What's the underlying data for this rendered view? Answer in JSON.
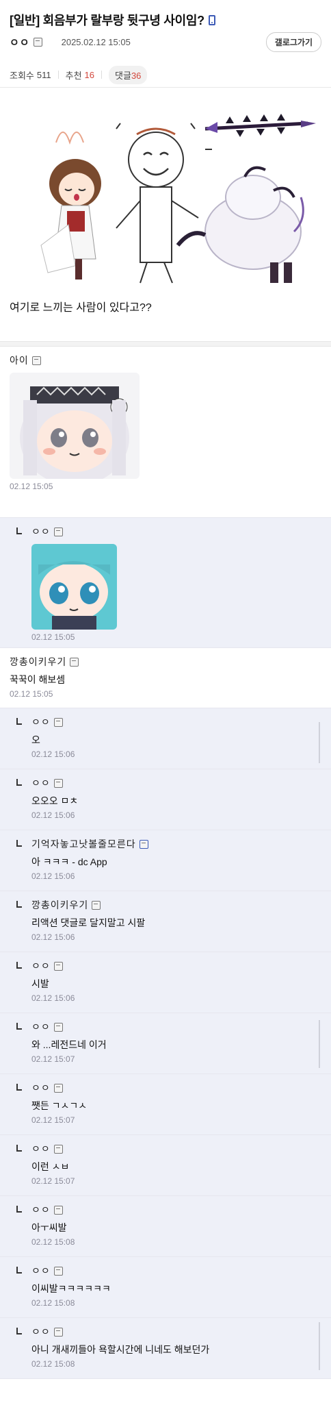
{
  "post": {
    "title": "[일반] 회음부가 랄부랑 뒷구녕 사이임?",
    "author": "ㅇㅇ",
    "date": "2025.02.12 15:05",
    "gallery_button": "갤로그가기",
    "views_label": "조회수",
    "views": "511",
    "recommend_label": "추천",
    "recommend": "16",
    "comments_label": "댓글",
    "comments": "36",
    "body": "여기로 느끼는 사람이 있다고??"
  },
  "comments": [
    {
      "name": "아이",
      "text": "",
      "date": "02.12 15:05",
      "reply": false,
      "sticker": "large"
    },
    {
      "name": "ㅇㅇ",
      "text": "",
      "date": "02.12 15:05",
      "reply": true,
      "sticker": "small"
    },
    {
      "name": "깡총이키우기",
      "text": "꾹꾹이 해보셈",
      "date": "02.12 15:05",
      "reply": false
    },
    {
      "name": "ㅇㅇ",
      "text": "오",
      "date": "02.12 15:06",
      "reply": true
    },
    {
      "name": "ㅇㅇ",
      "text": "오오오 ㅁㅊ",
      "date": "02.12 15:06",
      "reply": true
    },
    {
      "name": "기억자놓고낫볼줄모른다",
      "text": "아 ㅋㅋㅋ - dc App",
      "date": "02.12 15:06",
      "reply": true
    },
    {
      "name": "깡총이키우기",
      "text": "리액션 댓글로 달지말고 시팔",
      "date": "02.12 15:06",
      "reply": true
    },
    {
      "name": "ㅇㅇ",
      "text": "시발",
      "date": "02.12 15:06",
      "reply": true
    },
    {
      "name": "ㅇㅇ",
      "text": "와 ...레전드네 이거",
      "date": "02.12 15:07",
      "reply": true
    },
    {
      "name": "ㅇㅇ",
      "text": "쨋든 ㄱㅅㄱㅅ",
      "date": "02.12 15:07",
      "reply": true
    },
    {
      "name": "ㅇㅇ",
      "text": "이런 ㅅㅂ",
      "date": "02.12 15:07",
      "reply": true
    },
    {
      "name": "ㅇㅇ",
      "text": "아ㅜ씨발",
      "date": "02.12 15:08",
      "reply": true
    },
    {
      "name": "ㅇㅇ",
      "text": "이씨발ㅋㅋㅋㅋㅋㅋ",
      "date": "02.12 15:08",
      "reply": true
    },
    {
      "name": "ㅇㅇ",
      "text": "아니 개새끼들아 욕할시간에 니네도 해보던가",
      "date": "02.12 15:08",
      "reply": true
    }
  ],
  "colors": {
    "accent": "#3c5ab6",
    "reply_bg": "#eef0f8",
    "red": "#d2473c"
  }
}
